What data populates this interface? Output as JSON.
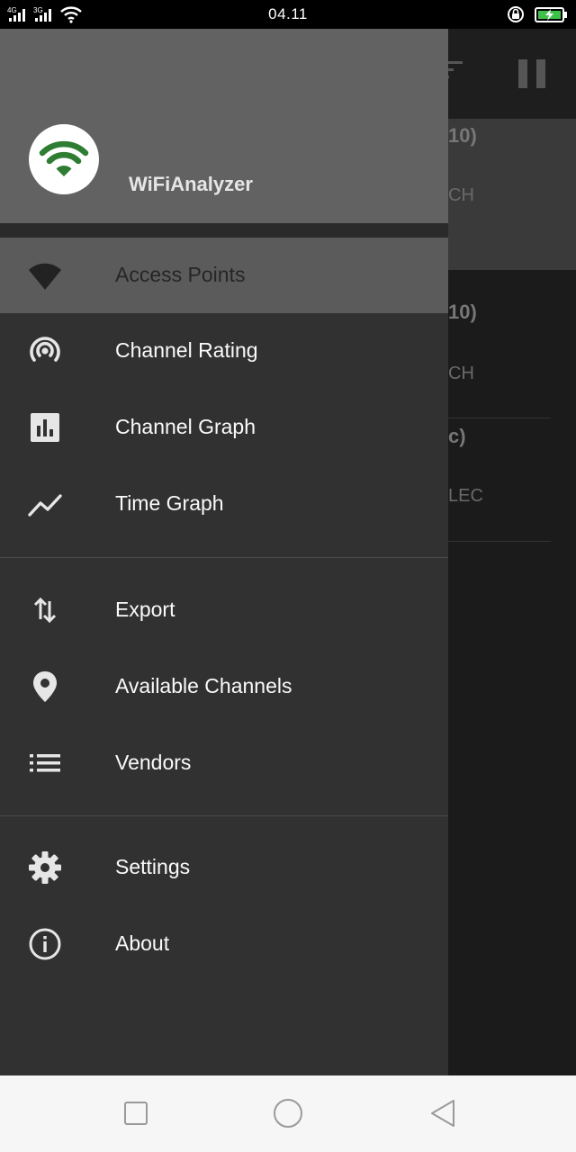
{
  "status_bar": {
    "time": "04.11",
    "network_1": "4G",
    "network_2": "3G"
  },
  "background_app": {
    "cards": [
      {
        "line1": "10)",
        "line2": "CH"
      },
      {
        "line1": "10)",
        "line2": "CH"
      },
      {
        "line1": "c)",
        "line2": "LEC"
      }
    ]
  },
  "drawer": {
    "app_name": "WiFiAnalyzer",
    "sections": [
      [
        {
          "label": "Access Points",
          "icon": "wifi-signal-icon",
          "selected": true
        },
        {
          "label": "Channel Rating",
          "icon": "channel-rating-icon"
        },
        {
          "label": "Channel Graph",
          "icon": "bar-chart-icon"
        },
        {
          "label": "Time Graph",
          "icon": "line-chart-icon"
        }
      ],
      [
        {
          "label": "Export",
          "icon": "swap-vertical-icon"
        },
        {
          "label": "Available Channels",
          "icon": "location-pin-icon"
        },
        {
          "label": "Vendors",
          "icon": "list-icon"
        }
      ],
      [
        {
          "label": "Settings",
          "icon": "gear-icon"
        },
        {
          "label": "About",
          "icon": "info-icon"
        }
      ]
    ]
  },
  "colors": {
    "header_bg": "#626262",
    "drawer_bg": "#313131",
    "selected_bg": "#5b5b5b",
    "logo_green": "#2e7d32"
  }
}
